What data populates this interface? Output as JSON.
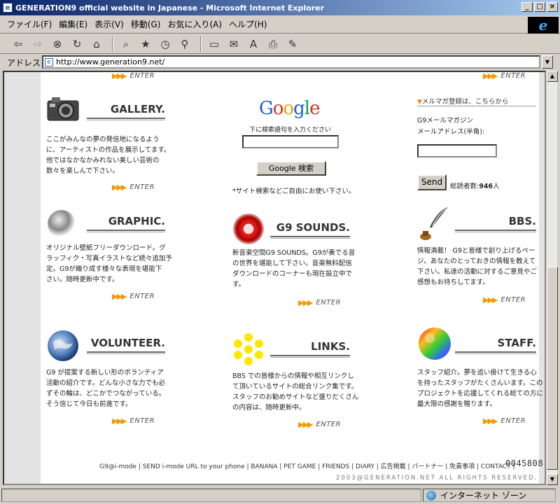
{
  "window": {
    "title": "GENERATION9 official website in Japanese - Microsoft Internet Explorer",
    "min": "_",
    "max": "□",
    "close": "×"
  },
  "menu": [
    "ファイル(F)",
    "編集(E)",
    "表示(V)",
    "移動(G)",
    "お気に入り(A)",
    "ヘルプ(H)"
  ],
  "address": {
    "label": "アドレス",
    "url": "http://www.generation9.net/"
  },
  "enter_label": "ENTER",
  "sections": {
    "gallery": {
      "title": "GALLERY.",
      "desc": [
        "ここがみんなの夢の発信地になるよう",
        "に、アーティストの作品を展示してます。",
        "他ではなかなかみれない美しい芸術の",
        "数々を楽しんで下さい。"
      ]
    },
    "graphic": {
      "title": "GRAPHIC.",
      "desc": [
        "オリジナル壁紙フリーダウンロード。グ",
        "ラッフィク・写真イラストなど続々追加予",
        "定。G9が織り成す様々な表現を堪能下",
        "さい。随時更新中です。"
      ]
    },
    "volunteer": {
      "title": "VOLUNTEER.",
      "desc": [
        "G9 が提案する新しい形のボランティア",
        "活動の紹介です。どんな小さな力でも必",
        "ずその輪は、どこかでつながっている。",
        "そう信じて今日も前進です。"
      ]
    },
    "sounds": {
      "title": "G9 SOUNDS.",
      "desc": [
        "新音楽空間G9 SOUNDS。G9が奏でる音",
        "の世界を堪能して下さい。音楽無料配信",
        "ダウンロードのコーナーも現在設立中で",
        "す。"
      ]
    },
    "links": {
      "title": "LINKS.",
      "desc": [
        "BBS での皆様からの情報や相互リンクし",
        "て頂いているサイトの総合リンク集です。",
        "スタッフのお勧めサイトなど盛りだくさん",
        "の内容は、随時更新中。"
      ]
    },
    "bbs": {
      "title": "BBS.",
      "desc": [
        "情報満載！ G9と皆様で創り上げるペー",
        "ジ。あなたのとっておきの情報を教えて",
        "下さい。私達の活動に対するご意見やご",
        "感想もお待ちしてます。"
      ]
    },
    "staff": {
      "title": "STAFF.",
      "desc": [
        "スタッフ紹介。夢を追い掛けて生きる心",
        "を持ったスタッフがたくさんいます。この",
        "プロジェクトを応援してくれる総ての方に",
        "最大限の感謝を贈ります。"
      ]
    }
  },
  "google": {
    "logo": "Google",
    "label": "下に検索語句を入力ください",
    "button": "Google 検索",
    "note": "*サイト検索などご自由にお使い下さい。"
  },
  "mailmag": {
    "header": "メルマガ登録は、こちらから",
    "title": "G9メールマガジン",
    "label": "メールアドレス(半角):",
    "send": "Send",
    "count_label": "総読者数:",
    "count": "946",
    "count_unit": "人"
  },
  "footer": {
    "links": "G9@i-mode | SEND i-mode URL to your phone | BANANA | PET GAME | FRIENDS | DIARY | 広告掲載 | パートナー | 免責事項 | CONTACT |",
    "counter": "0045808",
    "copyright": "2003@GENERATION.NET ALL RIGHTS RESERVED."
  },
  "status": {
    "zone": "インターネット ゾーン"
  }
}
